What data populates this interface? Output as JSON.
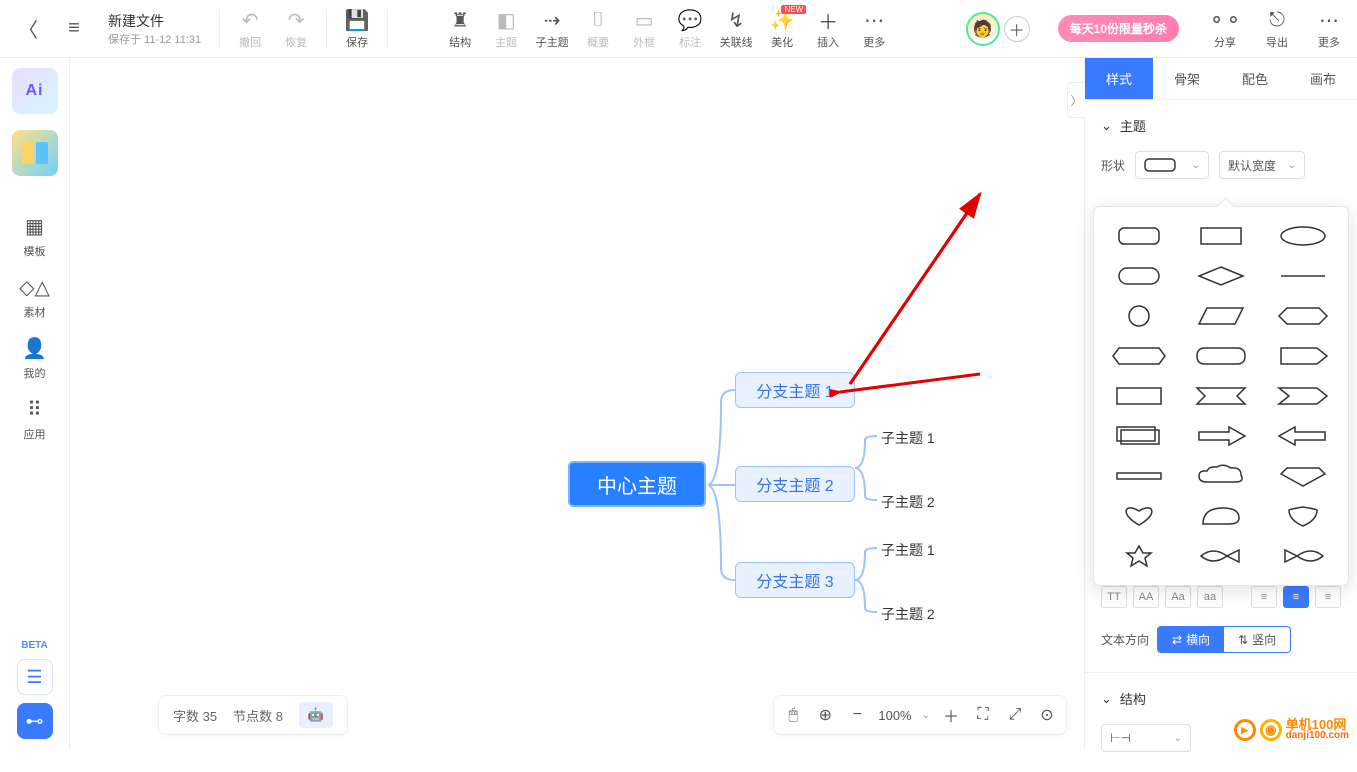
{
  "doc": {
    "title": "新建文件",
    "saved": "保存于 11-12 11:31"
  },
  "toolbar": {
    "undo": "撤回",
    "redo": "恢复",
    "save": "保存",
    "structure": "结构",
    "theme": "主题",
    "subtopic": "子主题",
    "summary": "概要",
    "boundary": "外框",
    "note": "标注",
    "relation": "关联线",
    "beautify": "美化",
    "insert": "插入",
    "more1": "更多",
    "share": "分享",
    "export": "导出",
    "more2": "更多",
    "new_badge": "NEW",
    "promo": "每天10份限量秒杀"
  },
  "leftrail": {
    "ai": "Ai",
    "templates": "模板",
    "assets": "素材",
    "mine": "我的",
    "apps": "应用",
    "beta": "BETA"
  },
  "mindmap": {
    "center": "中心主题",
    "branches": [
      "分支主题 1",
      "分支主题 2",
      "分支主题 3"
    ],
    "children": [
      "子主题 1",
      "子主题 2",
      "子主题 1",
      "子主题 2"
    ]
  },
  "rightpanel": {
    "tabs": [
      "样式",
      "骨架",
      "配色",
      "画布"
    ],
    "sections": {
      "topic": "主题",
      "structure": "结构"
    },
    "shape_label": "形状",
    "default_width": "默认宽度",
    "text_direction_label": "文本方向",
    "horizontal": "横向",
    "vertical": "竖向"
  },
  "status": {
    "chars_label": "字数",
    "chars": "35",
    "nodes_label": "节点数",
    "nodes": "8"
  },
  "zoom": {
    "value": "100%"
  },
  "watermark": {
    "text": "单机100网",
    "url": "danji100.com"
  }
}
